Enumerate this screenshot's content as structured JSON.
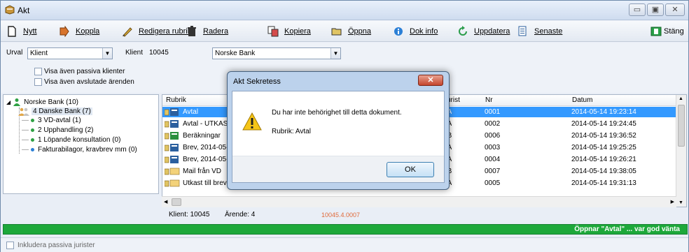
{
  "window": {
    "title": "Akt",
    "caption_buttons": [
      "▭",
      "▣",
      "✕"
    ]
  },
  "toolbar": [
    {
      "label": "Nytt",
      "icon": "new-document-icon"
    },
    {
      "label": "Koppla",
      "icon": "link-icon"
    },
    {
      "label": "Redigera rubrik",
      "icon": "edit-title-icon"
    },
    {
      "label": "Radera",
      "icon": "trash-icon"
    },
    {
      "label": "Kopiera",
      "icon": "copy-icon"
    },
    {
      "label": "Öppna",
      "icon": "open-folder-icon"
    },
    {
      "label": "Dok info",
      "icon": "info-icon"
    },
    {
      "label": "Uppdatera",
      "icon": "refresh-icon"
    },
    {
      "label": "Senaste",
      "icon": "recent-icon"
    },
    {
      "label": "Stäng",
      "icon": "close-window-icon"
    }
  ],
  "filter": {
    "urval_label": "Urval",
    "urval_value": "Klient",
    "klient_label": "Klient",
    "klient_number": "10045",
    "klient_name": "Norske Bank",
    "show_passive_clients": "Visa även passiva klienter",
    "show_closed_cases": "Visa även avslutade ärenden"
  },
  "tree": {
    "root": "Norske Bank (10)",
    "children": [
      {
        "label": "4 Danske Bank (7)",
        "selected": true
      },
      {
        "label": "3 VD-avtal (1)"
      },
      {
        "label": "2 Upphandling (2)"
      },
      {
        "label": "1 Löpande konsultation (0)"
      },
      {
        "label": "Fakturabilagor, kravbrev mm (0)"
      }
    ]
  },
  "list": {
    "columns": [
      "Rubrik",
      "Jurist",
      "Nr",
      "Datum"
    ],
    "rows": [
      {
        "rubrik": "Avtal",
        "jurist": "AA",
        "nr": "0001",
        "datum": "2014-05-14 19:23:14",
        "selected": true
      },
      {
        "rubrik": "Avtal - UTKAST",
        "jurist": "AA",
        "nr": "0002",
        "datum": "2014-05-14 19:24:45"
      },
      {
        "rubrik": "Beräkningar",
        "jurist": "BB",
        "nr": "0006",
        "datum": "2014-05-14 19:36:52"
      },
      {
        "rubrik": "Brev, 2014-05-14",
        "jurist": "AA",
        "nr": "0003",
        "datum": "2014-05-14 19:25:25"
      },
      {
        "rubrik": "Brev, 2014-05-14",
        "jurist": "AA",
        "nr": "0004",
        "datum": "2014-05-14 19:26:21"
      },
      {
        "rubrik": "Mail från VD",
        "jurist": "BB",
        "nr": "0007",
        "datum": "2014-05-14 19:38:05"
      },
      {
        "rubrik": "Utkast till brev",
        "jurist": "AA",
        "nr": "0005",
        "datum": "2014-05-14 19:31:13"
      }
    ]
  },
  "status": {
    "klient": "Klient: 10045",
    "arende": "Ärende: 4",
    "code": "10045.4.0007",
    "progress_text": "Öppnar \"Avtal\" ... var god vänta",
    "progress_color": "#1da83a"
  },
  "bottom": {
    "include_passive_lawyers": "Inkludera passiva jurister"
  },
  "dialog": {
    "title": "Akt Sekretess",
    "close": "✕",
    "message": "Du har inte behörighet till detta dokument.",
    "rubrik_line": "Rubrik: Avtal",
    "ok": "OK"
  }
}
